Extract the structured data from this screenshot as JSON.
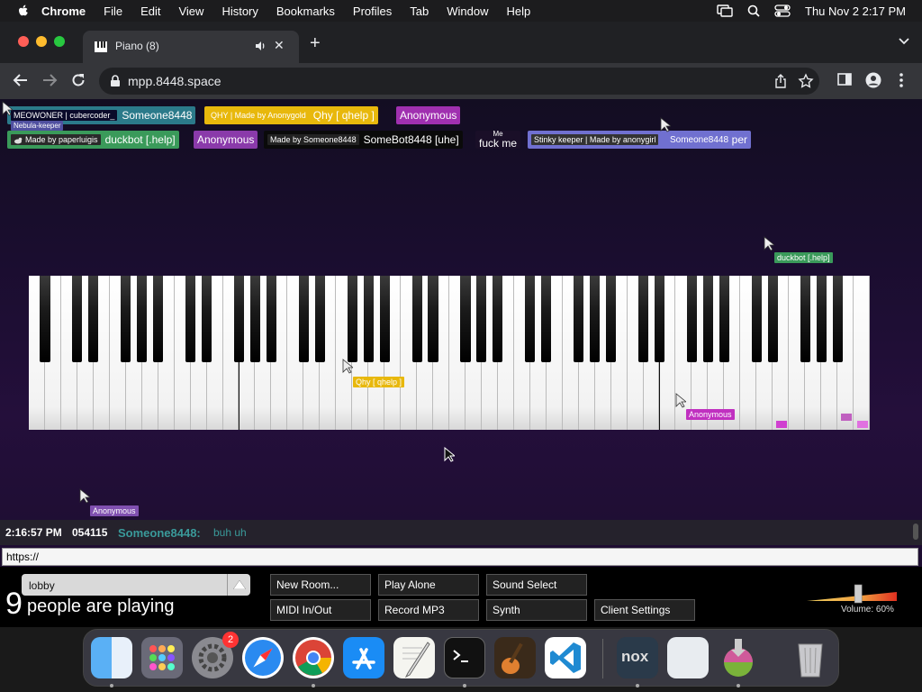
{
  "menubar": {
    "app_name": "Chrome",
    "items": [
      "File",
      "Edit",
      "View",
      "History",
      "Bookmarks",
      "Profiles",
      "Tab",
      "Window",
      "Help"
    ],
    "clock": "Thu Nov 2  2:17 PM"
  },
  "browser": {
    "tab_title": "Piano (8)",
    "url": "mpp.8448.space"
  },
  "names": {
    "row1": [
      {
        "sub": "MEOWONER | cubercoder_",
        "name": "Someone8448",
        "bg": "#2b7a8a",
        "sub_bg": "#0a0a2a"
      },
      {
        "sub": "QHY | Made by Anonygold",
        "name": "Qhy [ qhelp ]",
        "bg": "#e8b80c",
        "sub_bg": "#e8b80c"
      },
      {
        "sub": "",
        "name": "Anonymous",
        "bg": "#a030b0",
        "sub_bg": ""
      }
    ],
    "row2": [
      {
        "sub": "Made by paperluigis",
        "name": "duckbot [.help]",
        "bg": "#3a9a5a",
        "sub_bg": "#2a2a2a"
      },
      {
        "sub": "",
        "name": "Anonymous",
        "bg": "#8a3aaa",
        "sub_bg": ""
      },
      {
        "sub": "Made by Someone8448",
        "name": "SomeBot8448 [uhe]",
        "bg": "#0a0a0a",
        "sub_bg": "#222"
      },
      {
        "sub": "Me",
        "name": "fuck me",
        "bg": "#1a0f28",
        "sub_bg": ""
      },
      {
        "sub": "Stinky keeper | Made by anonygirl",
        "name": "Someone8448",
        "bg": "#7070d0",
        "sub_bg": "#333"
      }
    ],
    "cursor_overlaps": {
      "nebula": "Nebula-keeper",
      "keeper_tail": "per"
    }
  },
  "cursor_tags": [
    {
      "id": "cursor-tag-duckbot",
      "text": "duckbot [.help]",
      "bg": "#3a9a5a"
    },
    {
      "id": "cursor-tag-qhy",
      "text": "Qhy [ qhelp ]",
      "bg": "#e8b80c"
    },
    {
      "id": "cursor-tag-anon1",
      "text": "Anonymous",
      "bg": "#c030c0"
    },
    {
      "id": "cursor-tag-anon2",
      "text": "Anonymous",
      "bg": "#8050b0"
    }
  ],
  "piano": {
    "white_key_count": 52,
    "colors": {
      "white": "#ffffff",
      "black": "#000000",
      "highlight": "#d040d0"
    }
  },
  "chat": {
    "time": "2:16:57 PM",
    "id": "054115",
    "user": "Someone8448:",
    "message": "buh uh",
    "input_value": "https://"
  },
  "controls": {
    "room": "lobby",
    "player_count": "9",
    "player_text": "people are playing",
    "buttons": {
      "new_room": "New Room...",
      "play_alone": "Play Alone",
      "sound_select": "Sound Select",
      "midi": "MIDI In/Out",
      "record": "Record MP3",
      "synth": "Synth",
      "client_settings": "Client Settings"
    },
    "volume_label": "Volume: 60%",
    "volume": 0.6
  },
  "dock": {
    "badge": "2",
    "apps": [
      "finder-icon",
      "launchpad-icon",
      "system-settings-icon",
      "safari-icon",
      "chrome-icon",
      "app-store-icon",
      "textedit-icon",
      "terminal-icon",
      "garageband-icon",
      "vscode-icon",
      "nox-icon",
      "preview-icon",
      "installer-icon",
      "trash-icon"
    ],
    "nox_label": "nox"
  }
}
